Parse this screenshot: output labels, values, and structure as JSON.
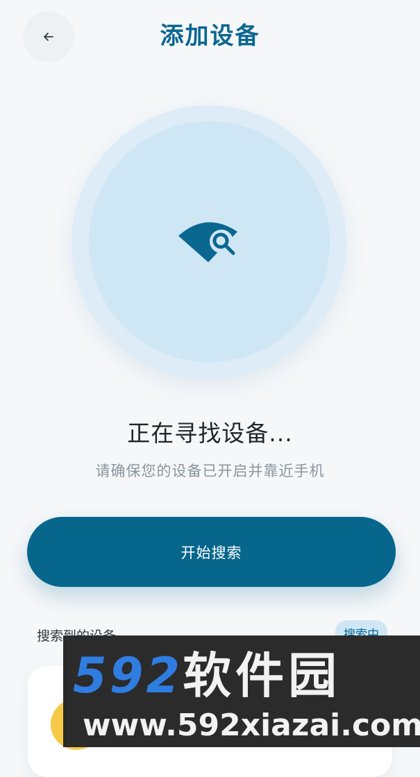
{
  "header": {
    "title": "添加设备",
    "back_icon": "arrow-left-icon"
  },
  "scan": {
    "icon": "wifi-search-icon",
    "colors": {
      "outer_ring": "#ddecf6",
      "inner_ring": "#cfe6f4",
      "icon": "#0a6790"
    }
  },
  "status": {
    "heading": "正在寻找设备...",
    "subtext": "请确保您的设备已开启并靠近手机"
  },
  "actions": {
    "start_search_label": "开始搜索"
  },
  "results": {
    "section_label": "搜索到的设备",
    "badge": "搜索中"
  },
  "watermark": {
    "brand_number": "592",
    "brand_text": "软件园",
    "url": "www.592xiazai.com"
  },
  "colors": {
    "accent": "#06668c",
    "title": "#0a6790",
    "background": "#f5f7f9",
    "avatar": "#f7c948"
  }
}
